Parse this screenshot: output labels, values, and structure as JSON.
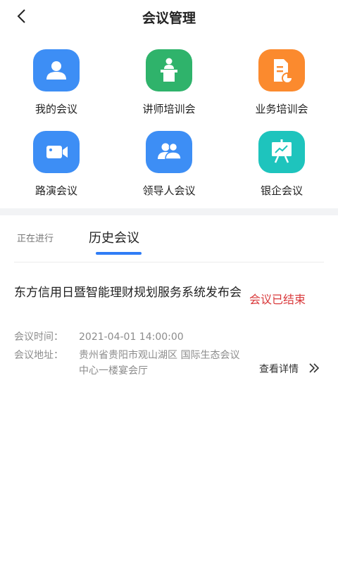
{
  "header": {
    "title": "会议管理",
    "back_icon": "chevron-left-icon"
  },
  "menu": {
    "items": [
      {
        "label": "我的会议",
        "icon": "user-icon",
        "color": "#3d8ef5"
      },
      {
        "label": "讲师培训会",
        "icon": "lecturer-podium-icon",
        "color": "#2fb36b"
      },
      {
        "label": "业务培训会",
        "icon": "document-chart-icon",
        "color": "#fb8a2e"
      },
      {
        "label": "路演会议",
        "icon": "video-camera-icon",
        "color": "#3d8ef5"
      },
      {
        "label": "领导人会议",
        "icon": "group-users-icon",
        "color": "#3d8ef5"
      },
      {
        "label": "银企会议",
        "icon": "presentation-board-icon",
        "color": "#1ec4bd"
      }
    ]
  },
  "tabs": {
    "ongoing": "正在进行",
    "history": "历史会议",
    "active": "history",
    "accent": "#2f7df6"
  },
  "meeting": {
    "title": "东方信用日暨智能理财规划服务系统发布会",
    "status": "会议已结束",
    "status_color": "#d9383a",
    "time_label": "会议时间：",
    "time_value": "2021-04-01 14:00:00",
    "address_label": "会议地址：",
    "address_value": "贵州省贵阳市观山湖区 国际生态会议中心一楼宴会厅",
    "detail_label": "查看详情",
    "detail_icon": "double-chevron-right-icon"
  }
}
